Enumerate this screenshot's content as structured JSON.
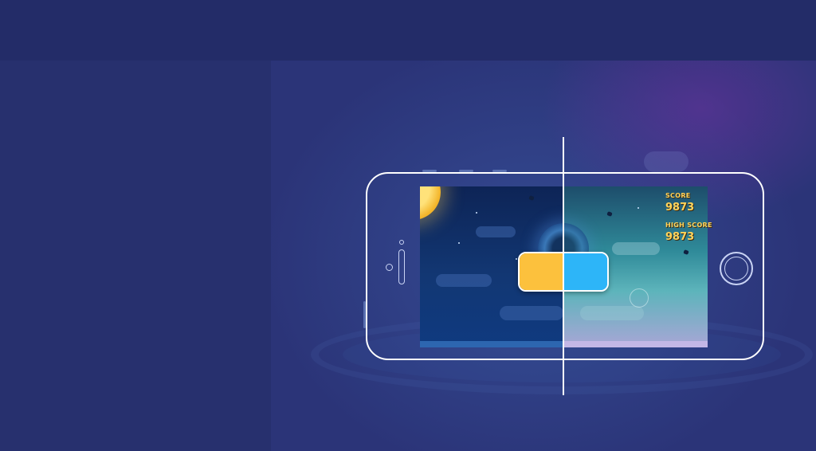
{
  "game_hud": {
    "score_label": "SCORE",
    "score_value": "9873",
    "high_score_label": "HIGH SCORE",
    "high_score_value": "9873"
  },
  "colors": {
    "background": "#27306e",
    "toggle_day": "#fcc13d",
    "toggle_night": "#2db5f8",
    "score_text": "#ffd35a"
  },
  "icons": {
    "phone": "phone-outline-icon",
    "home": "home-button-icon"
  }
}
